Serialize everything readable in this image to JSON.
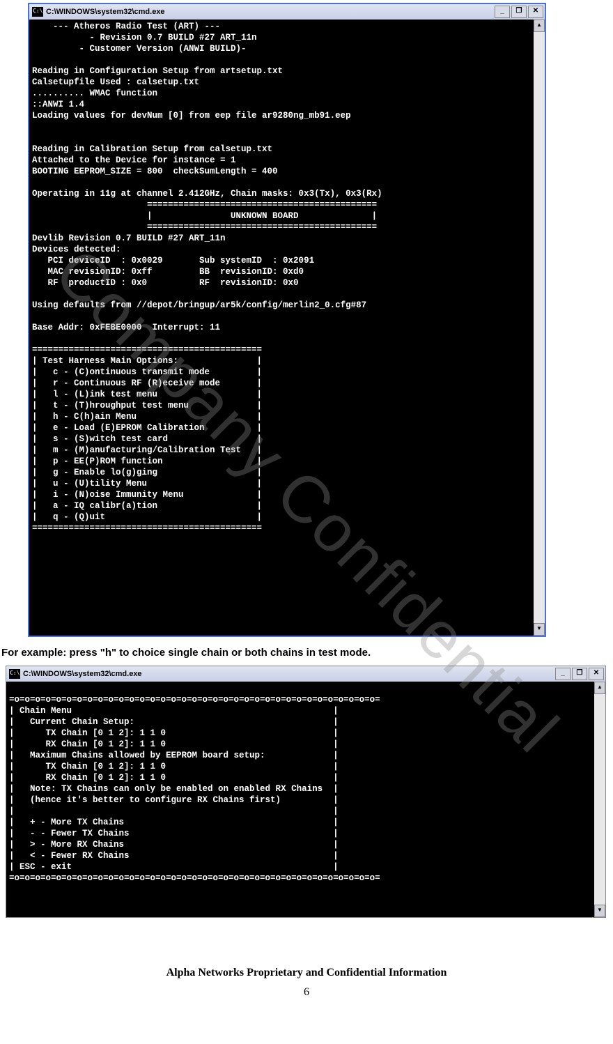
{
  "window": {
    "title": "C:\\WINDOWS\\system32\\cmd.exe"
  },
  "term1": "    --- Atheros Radio Test (ART) ---\n           - Revision 0.7 BUILD #27 ART_11n\n         - Customer Version (ANWI BUILD)-\n\nReading in Configuration Setup from artsetup.txt\nCalsetupfile Used : calsetup.txt\n.......... WMAC function\n::ANWI 1.4\nLoading values for devNum [0] from eep file ar9280ng_mb91.eep\n\n\nReading in Calibration Setup from calsetup.txt\nAttached to the Device for instance = 1\nBOOTING EEPROM_SIZE = 800  checkSumLength = 400\n\nOperating in 11g at channel 2.412GHz, Chain masks: 0x3(Tx), 0x3(Rx)\n                      ============================================\n                      |               UNKNOWN BOARD              |\n                      ============================================\nDevlib Revision 0.7 BUILD #27 ART_11n\nDevices detected:\n   PCI deviceID  : 0x0029       Sub systemID  : 0x2091\n   MAC revisionID: 0xff         BB  revisionID: 0xd0\n   RF  productID : 0x0          RF  revisionID: 0x0\n\nUsing defaults from //depot/bringup/ar5k/config/merlin2_0.cfg#87\n\nBase Addr: 0xFEBE0000  Interrupt: 11\n\n============================================\n| Test Harness Main Options:               |\n|   c - (C)ontinuous transmit mode         |\n|   r - Continuous RF (R)eceive mode       |\n|   l - (L)ink test menu                   |\n|   t - (T)hroughput test menu             |\n|   h - C(h)ain Menu                       |\n|   e - Load (E)EPROM Calibration          |\n|   s - (S)witch test card                 |\n|   m - (M)anufacturing/Calibration Test   |\n|   p - EE(P)ROM function                  |\n|   g - Enable lo(g)ging                   |\n|   u - (U)tility Menu                     |\n|   i - (N)oise Immunity Menu              |\n|   a - IQ calibr(a)tion                   |\n|   q - (Q)uit                             |\n============================================",
  "caption": "For example: press \"h\" to choice single chain or both chains in test mode.",
  "term2": "\n=o=o=o=o=o=o=o=o=o=o=o=o=o=o=o=o=o=o=o=o=o=o=o=o=o=o=o=o=o=o=o=o=o=o=o=\n| Chain Menu                                                  |\n|   Current Chain Setup:                                      |\n|      TX Chain [0 1 2]: 1 1 0                                |\n|      RX Chain [0 1 2]: 1 1 0                                |\n|   Maximum Chains allowed by EEPROM board setup:             |\n|      TX Chain [0 1 2]: 1 1 0                                |\n|      RX Chain [0 1 2]: 1 1 0                                |\n|   Note: TX Chains can only be enabled on enabled RX Chains  |\n|   (hence it's better to configure RX Chains first)          |\n|                                                             |\n|   + - More TX Chains                                        |\n|   - - Fewer TX Chains                                       |\n|   > - More RX Chains                                        |\n|   < - Fewer RX Chains                                       |\n| ESC - exit                                                  |\n=o=o=o=o=o=o=o=o=o=o=o=o=o=o=o=o=o=o=o=o=o=o=o=o=o=o=o=o=o=o=o=o=o=o=o=",
  "footer": "Alpha Networks Proprietary and Confidential Information",
  "pagenum": "6",
  "watermark": "Company Confidential",
  "ctrl": {
    "min": "_",
    "max": "❐",
    "close": "✕",
    "up": "▲",
    "down": "▼"
  }
}
